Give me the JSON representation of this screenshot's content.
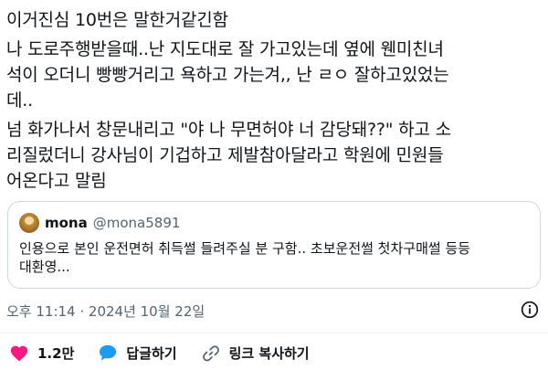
{
  "tweet": {
    "lines": [
      "이거진심 10번은 말한거같긴함",
      "나 도로주행받을때..난 지도대로 잘 가고있는데 옆에 웬미친녀",
      "석이 오더니 빵빵거리고 욕하고 가는겨,, 난 ㄹㅇ 잘하고있었는",
      "데..",
      "넘 화가나서 창문내리고 \"야 나 무면허야 너 감당돼??\" 하고 소",
      "리질렀더니 강사님이 기겁하고 제발참아달라고 학원에 민원들",
      "어온다고 말림"
    ]
  },
  "quote": {
    "name": "mona",
    "handle": "@mona5891",
    "lines": [
      "인용으로 본인 운전면허 취득썰 들려주실 분 구함.. 초보운전썰 첫차구매썰 등등",
      "대환영..."
    ]
  },
  "meta": {
    "timestamp": "오후 11:14 · 2024년 10월 22일"
  },
  "actions": {
    "like_count": "1.2만",
    "reply_label": "답글하기",
    "copy_link_label": "링크 복사하기"
  },
  "colors": {
    "like": "#f91880",
    "reply": "#1d9bf0",
    "secondary_text": "#536471",
    "border": "#cfd9de"
  },
  "icons": [
    "heart-icon",
    "speech-bubble-icon",
    "link-icon",
    "info-icon"
  ]
}
